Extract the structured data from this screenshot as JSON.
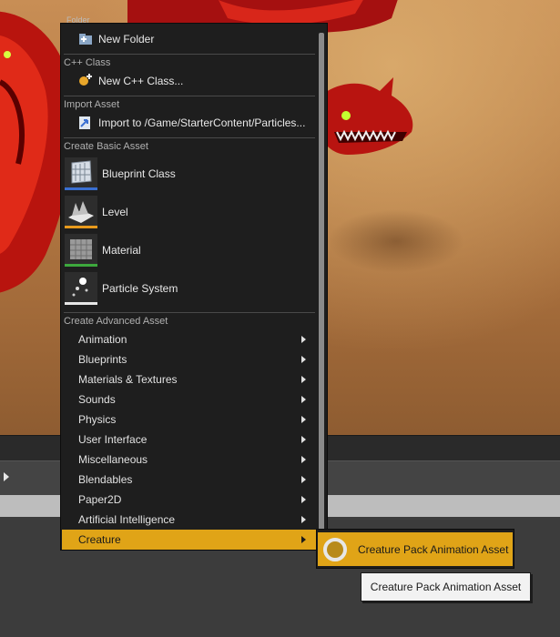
{
  "menu": {
    "peek_label": "Folder",
    "new_folder": "New Folder",
    "cpp_header": "C++ Class",
    "new_cpp_class": "New C++ Class...",
    "import_header": "Import Asset",
    "import_to": "Import to /Game/StarterContent/Particles...",
    "basic_header": "Create Basic Asset",
    "basic_items": [
      "Blueprint Class",
      "Level",
      "Material",
      "Particle System"
    ],
    "advanced_header": "Create Advanced Asset",
    "advanced_items": [
      "Animation",
      "Blueprints",
      "Materials & Textures",
      "Sounds",
      "Physics",
      "User Interface",
      "Miscellaneous",
      "Blendables",
      "Paper2D",
      "Artificial Intelligence",
      "Creature"
    ],
    "selected_item": "Creature"
  },
  "submenu": {
    "item": "Creature Pack Animation Asset"
  },
  "tooltip": {
    "text": "Creature Pack Animation Asset"
  },
  "colors": {
    "highlight": "#e0a417",
    "menu_bg": "#1e1e1e",
    "blueprint_bar": "#3a6fd1",
    "level_bar": "#e89a1c",
    "material_bar": "#3da83d",
    "particle_bar": "#e6e6e6"
  }
}
